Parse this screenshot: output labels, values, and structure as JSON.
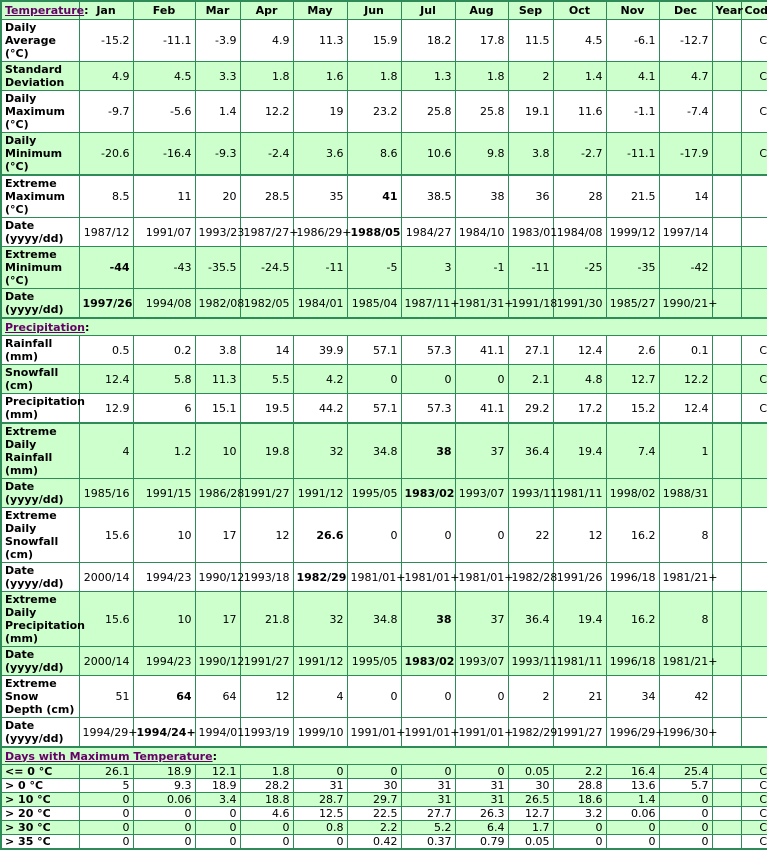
{
  "header": {
    "section": "Temperature",
    "months": [
      "Jan",
      "Feb",
      "Mar",
      "Apr",
      "May",
      "Jun",
      "Jul",
      "Aug",
      "Sep",
      "Oct",
      "Nov",
      "Dec"
    ],
    "year": "Year",
    "code": "Code"
  },
  "temperature": [
    {
      "label": "Daily Average (°C)",
      "values": [
        "-15.2",
        "-11.1",
        "-3.9",
        "4.9",
        "11.3",
        "15.9",
        "18.2",
        "17.8",
        "11.5",
        "4.5",
        "-6.1",
        "-12.7"
      ],
      "year": "",
      "code": "C",
      "bg": "w"
    },
    {
      "label": "Standard Deviation",
      "values": [
        "4.9",
        "4.5",
        "3.3",
        "1.8",
        "1.6",
        "1.8",
        "1.3",
        "1.8",
        "2",
        "1.4",
        "4.1",
        "4.7"
      ],
      "year": "",
      "code": "C",
      "bg": "g"
    },
    {
      "label": "Daily Maximum (°C)",
      "values": [
        "-9.7",
        "-5.6",
        "1.4",
        "12.2",
        "19",
        "23.2",
        "25.8",
        "25.8",
        "19.1",
        "11.6",
        "-1.1",
        "-7.4"
      ],
      "year": "",
      "code": "C",
      "bg": "w"
    },
    {
      "label": "Daily Minimum (°C)",
      "values": [
        "-20.6",
        "-16.4",
        "-9.3",
        "-2.4",
        "3.6",
        "8.6",
        "10.6",
        "9.8",
        "3.8",
        "-2.7",
        "-11.1",
        "-17.9"
      ],
      "year": "",
      "code": "C",
      "bg": "g"
    },
    {
      "label": "Extreme Maximum (°C)",
      "values": [
        "8.5",
        "11",
        "20",
        "28.5",
        "35",
        "41",
        "38.5",
        "38",
        "36",
        "28",
        "21.5",
        "14"
      ],
      "bold": [
        5
      ],
      "year": "",
      "code": "",
      "bg": "w",
      "thick": true
    },
    {
      "label": "Date (yyyy/dd)",
      "values": [
        "1987/12",
        "1991/07",
        "1993/23",
        "1987/27+",
        "1986/29+",
        "1988/05",
        "1984/27",
        "1984/10",
        "1983/01",
        "1984/08",
        "1999/12",
        "1997/14"
      ],
      "bold": [
        5
      ],
      "year": "",
      "code": "",
      "bg": "w"
    },
    {
      "label": "Extreme Minimum (°C)",
      "values": [
        "-44",
        "-43",
        "-35.5",
        "-24.5",
        "-11",
        "-5",
        "3",
        "-1",
        "-11",
        "-25",
        "-35",
        "-42"
      ],
      "bold": [
        0
      ],
      "year": "",
      "code": "",
      "bg": "g"
    },
    {
      "label": "Date (yyyy/dd)",
      "values": [
        "1997/26",
        "1994/08",
        "1982/08",
        "1982/05",
        "1984/01",
        "1985/04",
        "1987/11+",
        "1981/31+",
        "1991/18",
        "1991/30",
        "1985/27",
        "1990/21+"
      ],
      "bold": [
        0
      ],
      "year": "",
      "code": "",
      "bg": "g"
    }
  ],
  "precipitation_section": "Precipitation",
  "precipitation": [
    {
      "label": "Rainfall (mm)",
      "values": [
        "0.5",
        "0.2",
        "3.8",
        "14",
        "39.9",
        "57.1",
        "57.3",
        "41.1",
        "27.1",
        "12.4",
        "2.6",
        "0.1"
      ],
      "year": "",
      "code": "C",
      "bg": "w"
    },
    {
      "label": "Snowfall (cm)",
      "values": [
        "12.4",
        "5.8",
        "11.3",
        "5.5",
        "4.2",
        "0",
        "0",
        "0",
        "2.1",
        "4.8",
        "12.7",
        "12.2"
      ],
      "year": "",
      "code": "C",
      "bg": "g"
    },
    {
      "label": "Precipitation (mm)",
      "values": [
        "12.9",
        "6",
        "15.1",
        "19.5",
        "44.2",
        "57.1",
        "57.3",
        "41.1",
        "29.2",
        "17.2",
        "15.2",
        "12.4"
      ],
      "year": "",
      "code": "C",
      "bg": "w"
    },
    {
      "label": "Extreme Daily Rainfall (mm)",
      "values": [
        "4",
        "1.2",
        "10",
        "19.8",
        "32",
        "34.8",
        "38",
        "37",
        "36.4",
        "19.4",
        "7.4",
        "1"
      ],
      "bold": [
        6
      ],
      "year": "",
      "code": "",
      "bg": "g",
      "thick": true
    },
    {
      "label": "Date (yyyy/dd)",
      "values": [
        "1985/16",
        "1991/15",
        "1986/28",
        "1991/27",
        "1991/12",
        "1995/05",
        "1983/02",
        "1993/07",
        "1993/11",
        "1981/11",
        "1998/02",
        "1988/31"
      ],
      "bold": [
        6
      ],
      "year": "",
      "code": "",
      "bg": "g"
    },
    {
      "label": "Extreme Daily Snowfall (cm)",
      "values": [
        "15.6",
        "10",
        "17",
        "12",
        "26.6",
        "0",
        "0",
        "0",
        "22",
        "12",
        "16.2",
        "8"
      ],
      "bold": [
        4
      ],
      "year": "",
      "code": "",
      "bg": "w"
    },
    {
      "label": "Date (yyyy/dd)",
      "values": [
        "2000/14",
        "1994/23",
        "1990/12",
        "1993/18",
        "1982/29",
        "1981/01+",
        "1981/01+",
        "1981/01+",
        "1982/28",
        "1991/26",
        "1996/18",
        "1981/21+"
      ],
      "bold": [
        4
      ],
      "year": "",
      "code": "",
      "bg": "w"
    },
    {
      "label": "Extreme Daily Precipitation (mm)",
      "values": [
        "15.6",
        "10",
        "17",
        "21.8",
        "32",
        "34.8",
        "38",
        "37",
        "36.4",
        "19.4",
        "16.2",
        "8"
      ],
      "bold": [
        6
      ],
      "year": "",
      "code": "",
      "bg": "g"
    },
    {
      "label": "Date (yyyy/dd)",
      "values": [
        "2000/14",
        "1994/23",
        "1990/12",
        "1991/27",
        "1991/12",
        "1995/05",
        "1983/02",
        "1993/07",
        "1993/11",
        "1981/11",
        "1996/18",
        "1981/21+"
      ],
      "bold": [
        6
      ],
      "year": "",
      "code": "",
      "bg": "g"
    },
    {
      "label": "Extreme Snow Depth (cm)",
      "values": [
        "51",
        "64",
        "64",
        "12",
        "4",
        "0",
        "0",
        "0",
        "2",
        "21",
        "34",
        "42"
      ],
      "bold": [
        1
      ],
      "year": "",
      "code": "",
      "bg": "w"
    },
    {
      "label": "Date (yyyy/dd)",
      "values": [
        "1994/29+",
        "1994/24+",
        "1994/01",
        "1993/19",
        "1999/10",
        "1991/01+",
        "1991/01+",
        "1991/01+",
        "1982/29",
        "1991/27",
        "1996/29+",
        "1996/30+"
      ],
      "bold": [
        1
      ],
      "year": "",
      "code": "",
      "bg": "w"
    }
  ],
  "days_section": "Days with Maximum Temperature",
  "days": [
    {
      "label": "<= 0 °C",
      "values": [
        "26.1",
        "18.9",
        "12.1",
        "1.8",
        "0",
        "0",
        "0",
        "0",
        "0.05",
        "2.2",
        "16.4",
        "25.4"
      ],
      "year": "",
      "code": "C",
      "bg": "g"
    },
    {
      "label": "> 0 °C",
      "values": [
        "5",
        "9.3",
        "18.9",
        "28.2",
        "31",
        "30",
        "31",
        "31",
        "30",
        "28.8",
        "13.6",
        "5.7"
      ],
      "year": "",
      "code": "C",
      "bg": "w"
    },
    {
      "label": "> 10 °C",
      "values": [
        "0",
        "0.06",
        "3.4",
        "18.8",
        "28.7",
        "29.7",
        "31",
        "31",
        "26.5",
        "18.6",
        "1.4",
        "0"
      ],
      "year": "",
      "code": "C",
      "bg": "g"
    },
    {
      "label": "> 20 °C",
      "values": [
        "0",
        "0",
        "0",
        "4.6",
        "12.5",
        "22.5",
        "27.7",
        "26.3",
        "12.7",
        "3.2",
        "0.06",
        "0"
      ],
      "year": "",
      "code": "C",
      "bg": "w"
    },
    {
      "label": "> 30 °C",
      "values": [
        "0",
        "0",
        "0",
        "0",
        "0.8",
        "2.2",
        "5.2",
        "6.4",
        "1.7",
        "0",
        "0",
        "0"
      ],
      "year": "",
      "code": "C",
      "bg": "g"
    },
    {
      "label": "> 35 °C",
      "values": [
        "0",
        "0",
        "0",
        "0",
        "0",
        "0.42",
        "0.37",
        "0.79",
        "0.05",
        "0",
        "0",
        "0"
      ],
      "year": "",
      "code": "C",
      "bg": "w"
    }
  ]
}
